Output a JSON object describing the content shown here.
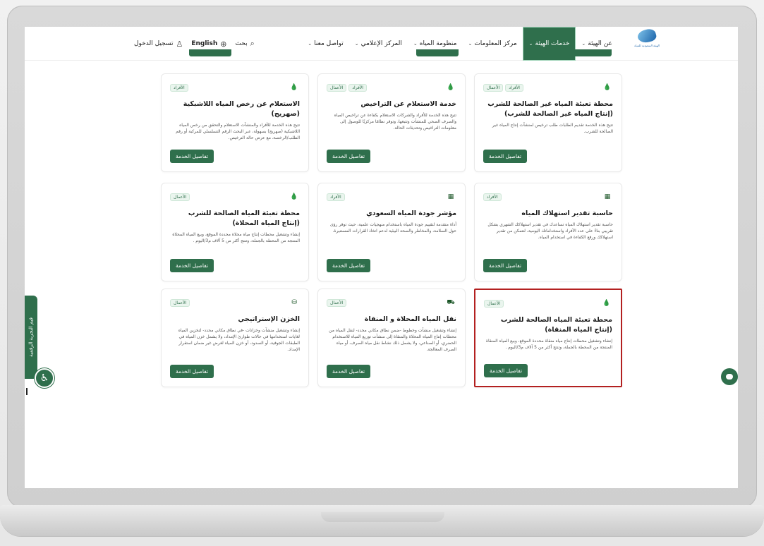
{
  "header": {
    "logo_text": "الهيئة السعودية للمياه",
    "nav": [
      {
        "label": "عن الهيئة",
        "active": false
      },
      {
        "label": "خدمات الهيئة",
        "active": true
      },
      {
        "label": "مركز المعلومات",
        "active": false
      },
      {
        "label": "منظومة المياه",
        "active": false
      },
      {
        "label": "المركز الإعلامي",
        "active": false
      },
      {
        "label": "تواصل معنا",
        "active": false
      }
    ],
    "search_label": "بحث",
    "language_label": "English",
    "login_label": "تسجيل الدخول"
  },
  "feedback_label": "قيم التجربة الرقمية",
  "accessibility_label": "♿",
  "cards": [
    {
      "title": "محطة تعبئة المياه غير الصالحة للشرب (إنتاج المياه غير الصالحة للشرب)",
      "desc": "تتيح هذه الخدمة تقديم الطلبات طلب ترخيص لمنشآت إنتاج المياه غير الصالحة للشرب.",
      "tags": [
        "الأفراد",
        "الأعمال"
      ],
      "button": "تفاصيل الخدمة",
      "icon": "drop-icon"
    },
    {
      "title": "خدمة الاستعلام عن التراخيص",
      "desc": "تتيح هذه الخدمة للأفراد والشركات الاستعلام بكفاءة عن تراخيص المياه والصرف الصحي للمنشآت وتتبعها، وتوفر نظامًا مركزيًا للوصول إلى معلومات التراخيص وتحديثات الحالة.",
      "tags": [
        "الأفراد",
        "الأعمال"
      ],
      "button": "تفاصيل الخدمة",
      "icon": "drop-icon"
    },
    {
      "title": "الاستعلام عن رخص المياه اللاشبكية (صهريج)",
      "desc": "تتيح هذه الخدمة للأفراد والمنشآت الاستعلام والتحقق من رخص المياه اللاشبكية (صهريج) بسهولة، عبر البحث الرقم التسلسلي للمركبة أو رقم الطلب/الرخصة، مع عرض حالة الترخيص.",
      "tags": [
        "الأفراد"
      ],
      "button": "تفاصيل الخدمة",
      "icon": "drop-icon"
    },
    {
      "title": "حاسبة تقدير استهلاك المياه",
      "desc": "حاسبة تقدير استهلاك المياه تساعدك في تقدير استهلاكك الشهري بشكل تقريبي بناءً على عدد الأفراد واستخداماتك اليومية، لتتمكن من تقدير استهلاكك ورفع الكفاءة في استخدام المياه.",
      "tags": [
        "الأفراد"
      ],
      "button": "تفاصيل الخدمة",
      "icon": "calculator-icon"
    },
    {
      "title": "مؤشر جودة المياه السعودي",
      "desc": "أداة متقدمة لتقييم جودة المياه باستخدام منهجيات علمية، حيث توفر رؤى حول السلامة، والمخاطر والصحة البيئية لدعم اتخاذ القرارات المستنيرة.",
      "tags": [
        "الأفراد"
      ],
      "button": "تفاصيل الخدمة",
      "icon": "calculator-icon"
    },
    {
      "title": "محطة تعبئة المياه الصالحة للشرب (إنتاج المياه المحلاة)",
      "desc": "إنشاء وتشغيل محطات إنتاج مياه محلاة محددة الموقع، وبيع المياه المحلاة المنتجة من المحطة بالجملة، وتنتج أكثر من 5 آلاف م3/اليوم .",
      "tags": [
        "الأعمال"
      ],
      "button": "تفاصيل الخدمة",
      "icon": "drop-icon"
    },
    {
      "title": "محطة تعبئة المياه الصالحة للشرب (إنتاج المياه المنقاة)",
      "desc": "إنشاء وتشغيل محطات إنتاج مياه منقاة محددة الموقع، وبيع المياه المنقاة المنتجة من المحطة بالجملة، وتنتج أكثر من 5 آلاف م3/اليوم .",
      "tags": [
        "الأعمال"
      ],
      "button": "تفاصيل الخدمة",
      "icon": "drop-icon",
      "selected": true
    },
    {
      "title": "نقل المياه المحلاة و المنقاة",
      "desc": "إنشاء وتشغيل منشآت وخطوط -ضمن نطاق مكاني محدد- لنقل المياه من محطات إنتاج المياه المحلاة والمنقاة إلى منشآت توزيع المياه للاستخدام الحضري، أو الصناعي، ولا يشمل ذلك نشاط نقل مياه الصرف، أو مياه الصرف المعالجة.",
      "tags": [
        "الأعمال"
      ],
      "button": "تفاصيل الخدمة",
      "icon": "truck-icon"
    },
    {
      "title": "الخزن الإستراتيجي",
      "desc": "إنشاء وتشغيل منشآت وخزانات -في نطاق مكاني محدد- لتخزين المياه لغايات استخدامها في حالات طوارئ الإمداد، ولا يشمل خزن المياه في الطبقات الجوفية، أو السدود، أو خزن المياه لغرض غير ضمان استقرار الإمداد.",
      "tags": [
        "الأعمال"
      ],
      "button": "تفاصيل الخدمة",
      "icon": "storage-icon"
    }
  ]
}
